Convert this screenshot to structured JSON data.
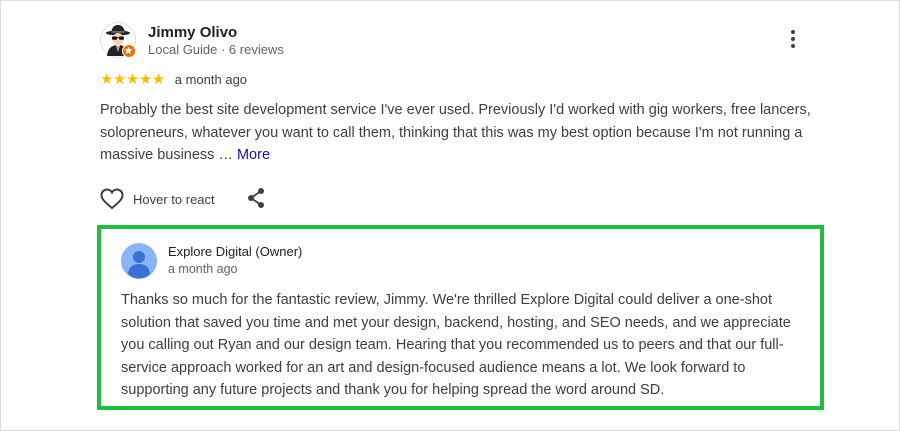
{
  "review": {
    "author_name": "Jimmy Olivo",
    "author_meta": "Local Guide · 6 reviews",
    "stars": "★★★★★",
    "rating": 5,
    "date": "a month ago",
    "text_truncated": "Probably the best site development service I've ever used. Previously I'd worked with gig workers, free lancers, solopreneurs, whatever you want to call them, thinking that this was my best option because I'm not running a massive business …",
    "more_label": "More",
    "react_label": "Hover to react",
    "icons": {
      "avatar": "spy-avatar-icon",
      "badge": "local-guide-star-icon",
      "menu": "more-vert-icon",
      "react": "heart-outline-icon",
      "share": "share-icon"
    }
  },
  "owner_response": {
    "name": "Explore Digital (Owner)",
    "date": "a month ago",
    "text": "Thanks so much for the fantastic review, Jimmy. We're thrilled Explore Digital could deliver a one-shot solution that saved you time and met your design, backend, hosting, and SEO needs, and we appreciate you calling out Ryan and our design team. Hearing that you recommended us to peers and that our full-service approach worked for an art and design-focused audience means a lot. We look forward to supporting any future projects and thank you for helping spread the word around SD.",
    "icons": {
      "avatar": "default-profile-icon"
    }
  },
  "colors": {
    "star": "#fbbc04",
    "link": "#1a0dab",
    "highlight_border": "#22bb44",
    "badge": "#e8710a",
    "default_avatar": "#8ab4f8"
  }
}
